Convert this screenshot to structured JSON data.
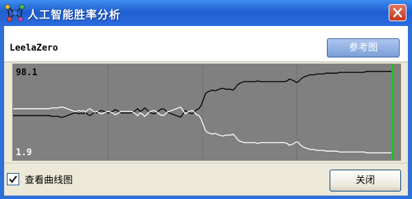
{
  "window": {
    "title": "人工智能胜率分析",
    "close_icon": "close-icon"
  },
  "header": {
    "engine_name": "LeelaZero",
    "reference_button_label": "参考图"
  },
  "chart_data": {
    "type": "line",
    "y_top_label": "98.1",
    "y_bottom_label": "1.9",
    "ylim": [
      0,
      100
    ],
    "grid": true,
    "vertical_gridlines": 3,
    "background_color": "#808080",
    "current_move_marker_color": "#22c022",
    "series": [
      {
        "color": "#000000",
        "values": [
          46,
          46,
          46,
          46,
          46,
          46,
          46,
          46,
          46,
          46,
          46,
          46,
          46,
          46,
          46,
          46,
          46,
          45,
          45,
          45,
          45,
          44,
          44,
          45,
          46,
          47,
          48,
          49,
          49,
          48,
          49,
          48,
          50,
          47,
          46,
          48,
          50,
          49,
          51,
          52,
          51,
          50,
          49,
          50,
          51,
          53,
          52,
          50,
          49,
          49,
          49,
          49,
          49,
          50,
          52,
          54,
          51,
          52,
          55,
          53,
          50,
          49,
          48,
          49,
          51,
          53,
          54,
          53,
          50,
          49,
          48,
          47,
          46,
          45,
          44,
          48,
          52,
          50,
          49,
          48,
          50,
          53,
          54,
          58,
          65,
          72,
          74,
          75,
          76,
          75,
          76,
          77,
          78,
          78,
          77,
          77,
          77,
          76,
          78,
          82,
          84,
          85,
          86,
          86,
          86,
          86,
          86,
          86,
          87,
          86,
          86,
          86,
          86,
          86,
          86,
          86,
          86,
          86,
          86,
          86,
          86,
          87,
          89,
          88,
          87,
          85,
          86,
          89,
          91,
          92,
          93,
          94,
          94,
          94,
          95,
          95,
          95,
          95,
          96,
          96,
          96,
          96,
          96,
          96,
          97,
          97,
          97,
          97,
          97,
          97,
          97,
          97,
          97,
          97,
          97,
          97,
          98,
          98,
          98,
          98,
          98,
          98,
          98,
          98,
          98,
          98,
          98,
          98
        ]
      },
      {
        "color": "#ffffff",
        "values": [
          54,
          54,
          54,
          54,
          54,
          54,
          54,
          54,
          54,
          54,
          54,
          54,
          54,
          54,
          54,
          54,
          54,
          55,
          55,
          55,
          55,
          56,
          56,
          55,
          54,
          53,
          52,
          51,
          51,
          52,
          51,
          52,
          50,
          53,
          54,
          52,
          50,
          51,
          49,
          48,
          49,
          50,
          51,
          50,
          49,
          47,
          48,
          50,
          51,
          51,
          51,
          51,
          51,
          50,
          48,
          46,
          49,
          48,
          45,
          47,
          50,
          51,
          52,
          51,
          49,
          47,
          46,
          47,
          50,
          51,
          52,
          53,
          54,
          55,
          56,
          52,
          48,
          50,
          51,
          52,
          50,
          47,
          46,
          42,
          35,
          28,
          26,
          25,
          24,
          25,
          24,
          23,
          22,
          22,
          23,
          23,
          23,
          24,
          22,
          18,
          16,
          15,
          14,
          14,
          14,
          14,
          14,
          14,
          13,
          14,
          14,
          14,
          14,
          14,
          14,
          14,
          14,
          14,
          14,
          14,
          14,
          13,
          11,
          12,
          13,
          15,
          14,
          11,
          9,
          8,
          7,
          6,
          6,
          6,
          5,
          5,
          5,
          5,
          4,
          4,
          4,
          4,
          4,
          4,
          3,
          3,
          3,
          3,
          3,
          3,
          3,
          3,
          3,
          3,
          3,
          3,
          2,
          2,
          2,
          2,
          2,
          2,
          2,
          2,
          2,
          2,
          2,
          2
        ]
      }
    ]
  },
  "footer": {
    "checkbox_label": "查看曲线图",
    "checkbox_checked": true,
    "close_button_label": "关闭"
  }
}
